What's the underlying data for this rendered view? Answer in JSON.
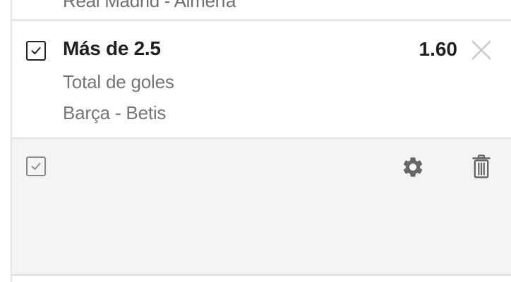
{
  "previous_bet": {
    "match": "Real Madrid - Almería"
  },
  "bet": {
    "selection": "Más de 2.5",
    "odds": "1.60",
    "market": "Total de goles",
    "match": "Barça - Betis",
    "checked": true
  },
  "footer": {
    "icons": [
      "checkbox-icon",
      "gear-icon",
      "trash-icon"
    ]
  },
  "colors": {
    "text_primary": "#1f1f1f",
    "text_secondary": "#757575",
    "footer_bg": "#f4f4f4",
    "icon_gray": "#666666"
  }
}
